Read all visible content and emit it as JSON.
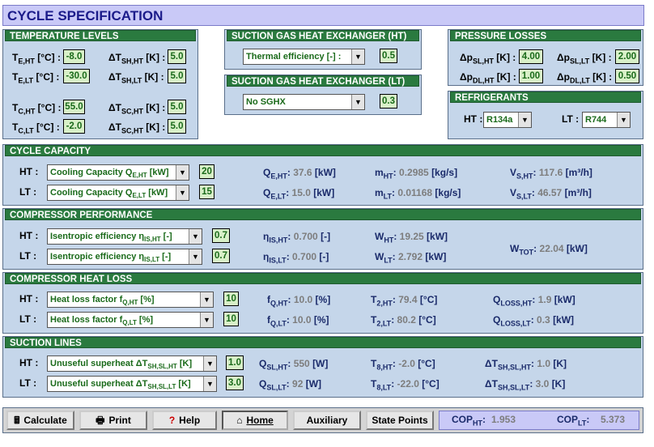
{
  "title": "CYCLE SPECIFICATION",
  "temperature_levels": {
    "header": "TEMPERATURE LEVELS",
    "rows": [
      {
        "l1": "T",
        "s1": "E,HT",
        "u1": " [°C] :",
        "v1": "-8.0",
        "l2": "ΔT",
        "s2": "SH,HT",
        "u2": " [K] :",
        "v2": "5.0"
      },
      {
        "l1": "T",
        "s1": "E,LT",
        "u1": " [°C] :",
        "v1": "-30.0",
        "l2": "ΔT",
        "s2": "SH,LT",
        "u2": " [K] :",
        "v2": "5.0"
      },
      {
        "l1": "T",
        "s1": "C,HT",
        "u1": " [°C] :",
        "v1": "55.0",
        "l2": "ΔT",
        "s2": "SC,HT",
        "u2": " [K] :",
        "v2": "5.0"
      },
      {
        "l1": "T",
        "s1": "C,LT",
        "u1": " [°C] :",
        "v1": "-2.0",
        "l2": "ΔT",
        "s2": "SC,HT",
        "u2": " [K] :",
        "v2": "5.0"
      }
    ]
  },
  "sghx_ht": {
    "header": "SUCTION GAS HEAT EXCHANGER (HT)",
    "select": "Thermal efficiency [-] :",
    "value": "0.5"
  },
  "sghx_lt": {
    "header": "SUCTION GAS HEAT EXCHANGER (LT)",
    "select": "No SGHX",
    "value": "0.3"
  },
  "pressure_losses": {
    "header": "PRESSURE LOSSES",
    "rows": [
      {
        "l1": "Δp",
        "s1": "SL,HT",
        "u1": " [K] :",
        "v1": "4.00",
        "l2": "Δp",
        "s2": "SL,LT",
        "u2": " [K] :",
        "v2": "2.00"
      },
      {
        "l1": "Δp",
        "s1": "DL,HT",
        "u1": " [K] :",
        "v1": "1.00",
        "l2": "Δp",
        "s2": "DL,LT",
        "u2": " [K] :",
        "v2": "0.50"
      }
    ]
  },
  "refrigerants": {
    "header": "REFRIGERANTS",
    "ht_label": "HT :",
    "ht_value": "R134a",
    "lt_label": "LT :",
    "lt_value": "R744"
  },
  "cycle_capacity": {
    "header": "CYCLE CAPACITY",
    "rows": [
      {
        "label": "HT :",
        "sel": "Cooling Capacity Q",
        "sel_sub": "E,HT",
        "sel_unit": " [kW]",
        "input": "20",
        "r1n": "Q",
        "r1s": "E,HT",
        "r1v": "37.6",
        "r1u": "[kW]",
        "r2n": "m",
        "r2s": "HT",
        "r2v": "0.2985",
        "r2u": "[kg/s]",
        "r3n": "V",
        "r3s": "S,HT",
        "r3v": "117.6",
        "r3u": "[m³/h]"
      },
      {
        "label": "LT :",
        "sel": "Cooling Capacity Q",
        "sel_sub": "E,LT",
        "sel_unit": " [kW]",
        "input": "15",
        "r1n": "Q",
        "r1s": "E,LT",
        "r1v": "15.0",
        "r1u": "[kW]",
        "r2n": "m",
        "r2s": "LT",
        "r2v": "0.01168",
        "r2u": "[kg/s]",
        "r3n": "V",
        "r3s": "S,LT",
        "r3v": "46.57",
        "r3u": "[m³/h]"
      }
    ]
  },
  "compressor_performance": {
    "header": "COMPRESSOR PERFORMANCE",
    "rows": [
      {
        "label": "HT :",
        "sel": "Isentropic efficiency η",
        "sel_sub": "IS,HT",
        "sel_unit": " [-]",
        "input": "0.7",
        "r1n": "η",
        "r1s": "IS,HT",
        "r1v": "0.700",
        "r1u": "[-]",
        "r2n": "W",
        "r2s": "HT",
        "r2v": "19.25",
        "r2u": "[kW]"
      },
      {
        "label": "LT :",
        "sel": "Isentropic efficiency η",
        "sel_sub": "IS,LT",
        "sel_unit": " [-]",
        "input": "0.7",
        "r1n": "η",
        "r1s": "IS,LT",
        "r1v": "0.700",
        "r1u": "[-]",
        "r2n": "W",
        "r2s": "LT",
        "r2v": "2.792",
        "r2u": "[kW]"
      }
    ],
    "total": {
      "n": "W",
      "s": "TOT",
      "v": "22.04",
      "u": "[kW]"
    }
  },
  "compressor_heat_loss": {
    "header": "COMPRESSOR HEAT LOSS",
    "rows": [
      {
        "label": "HT :",
        "sel": "Heat loss factor f",
        "sel_sub": "Q,HT",
        "sel_unit": " [%]",
        "input": "10",
        "r1n": "f",
        "r1s": "Q,HT",
        "r1v": "10.0",
        "r1u": "[%]",
        "r2n": "T",
        "r2s": "2,HT",
        "r2v": "79.4",
        "r2u": "[°C]",
        "r3n": "Q",
        "r3s": "LOSS,HT",
        "r3v": "1.9",
        "r3u": "[kW]"
      },
      {
        "label": "LT :",
        "sel": "Heat loss factor f",
        "sel_sub": "Q,LT",
        "sel_unit": " [%]",
        "input": "10",
        "r1n": "f",
        "r1s": "Q,LT",
        "r1v": "10.0",
        "r1u": "[%]",
        "r2n": "T",
        "r2s": "2,LT",
        "r2v": "80.2",
        "r2u": "[°C]",
        "r3n": "Q",
        "r3s": "LOSS,LT",
        "r3v": "0.3",
        "r3u": "[kW]"
      }
    ]
  },
  "suction_lines": {
    "header": "SUCTION LINES",
    "rows": [
      {
        "label": "HT :",
        "sel": "Unuseful superheat ΔT",
        "sel_sub": "SH,SL,HT",
        "sel_unit": " [K]",
        "input": "1.0",
        "r1n": "Q",
        "r1s": "SL,HT",
        "r1v": "550",
        "r1u": "[W]",
        "r2n": "T",
        "r2s": "8,HT",
        "r2v": "-2.0",
        "r2u": "[°C]",
        "r3n": "ΔT",
        "r3s": "SH,SL,HT",
        "r3v": "1.0",
        "r3u": "[K]"
      },
      {
        "label": "LT :",
        "sel": "Unuseful superheat ΔT",
        "sel_sub": "SH,SL,LT",
        "sel_unit": " [K]",
        "input": "3.0",
        "r1n": "Q",
        "r1s": "SL,LT",
        "r1v": "92",
        "r1u": "[W]",
        "r2n": "T",
        "r2s": "8,LT",
        "r2v": "-22.0",
        "r2u": "[°C]",
        "r3n": "ΔT",
        "r3s": "SH,SL,LT",
        "r3v": "3.0",
        "r3u": "[K]"
      }
    ]
  },
  "toolbar": {
    "calculate": "Calculate",
    "print": "Print",
    "help": "Help",
    "home": "Home",
    "auxiliary": "Auxiliary",
    "state_points": "State Points",
    "cop_ht_label": "COP",
    "cop_ht_sub": "HT",
    "cop_ht_value": "1.953",
    "cop_lt_label": "COP",
    "cop_lt_sub": "LT",
    "cop_lt_value": "5.373"
  }
}
